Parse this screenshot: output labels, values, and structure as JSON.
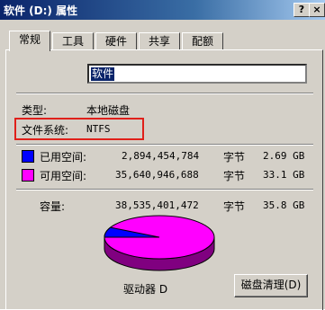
{
  "window": {
    "title": "软件 (D:) 属性",
    "help_label": "?",
    "close_label": "×"
  },
  "tabs": [
    {
      "label": "常规",
      "active": true
    },
    {
      "label": "工具",
      "active": false
    },
    {
      "label": "硬件",
      "active": false
    },
    {
      "label": "共享",
      "active": false
    },
    {
      "label": "配额",
      "active": false
    }
  ],
  "general": {
    "volume_name": "软件",
    "type_label": "类型:",
    "type_value": "本地磁盘",
    "fs_label": "文件系统:",
    "fs_value": "NTFS",
    "used_label": "已用空间:",
    "used_bytes": "2,894,454,784",
    "used_unit": "字节",
    "used_human": "2.69 GB",
    "free_label": "可用空间:",
    "free_bytes": "35,640,946,688",
    "free_unit": "字节",
    "free_human": "33.1 GB",
    "capacity_label": "容量:",
    "capacity_bytes": "38,535,401,472",
    "capacity_unit": "字节",
    "capacity_human": "35.8 GB",
    "drive_label": "驱动器 D",
    "cleanup_label": "磁盘清理(D)"
  },
  "colors": {
    "used": "#0000ff",
    "free": "#ff00ff",
    "highlight": "#e0201a"
  },
  "chart_data": {
    "type": "pie",
    "categories": [
      "已用空间",
      "可用空间"
    ],
    "values": [
      2894454784,
      35640946688
    ]
  }
}
